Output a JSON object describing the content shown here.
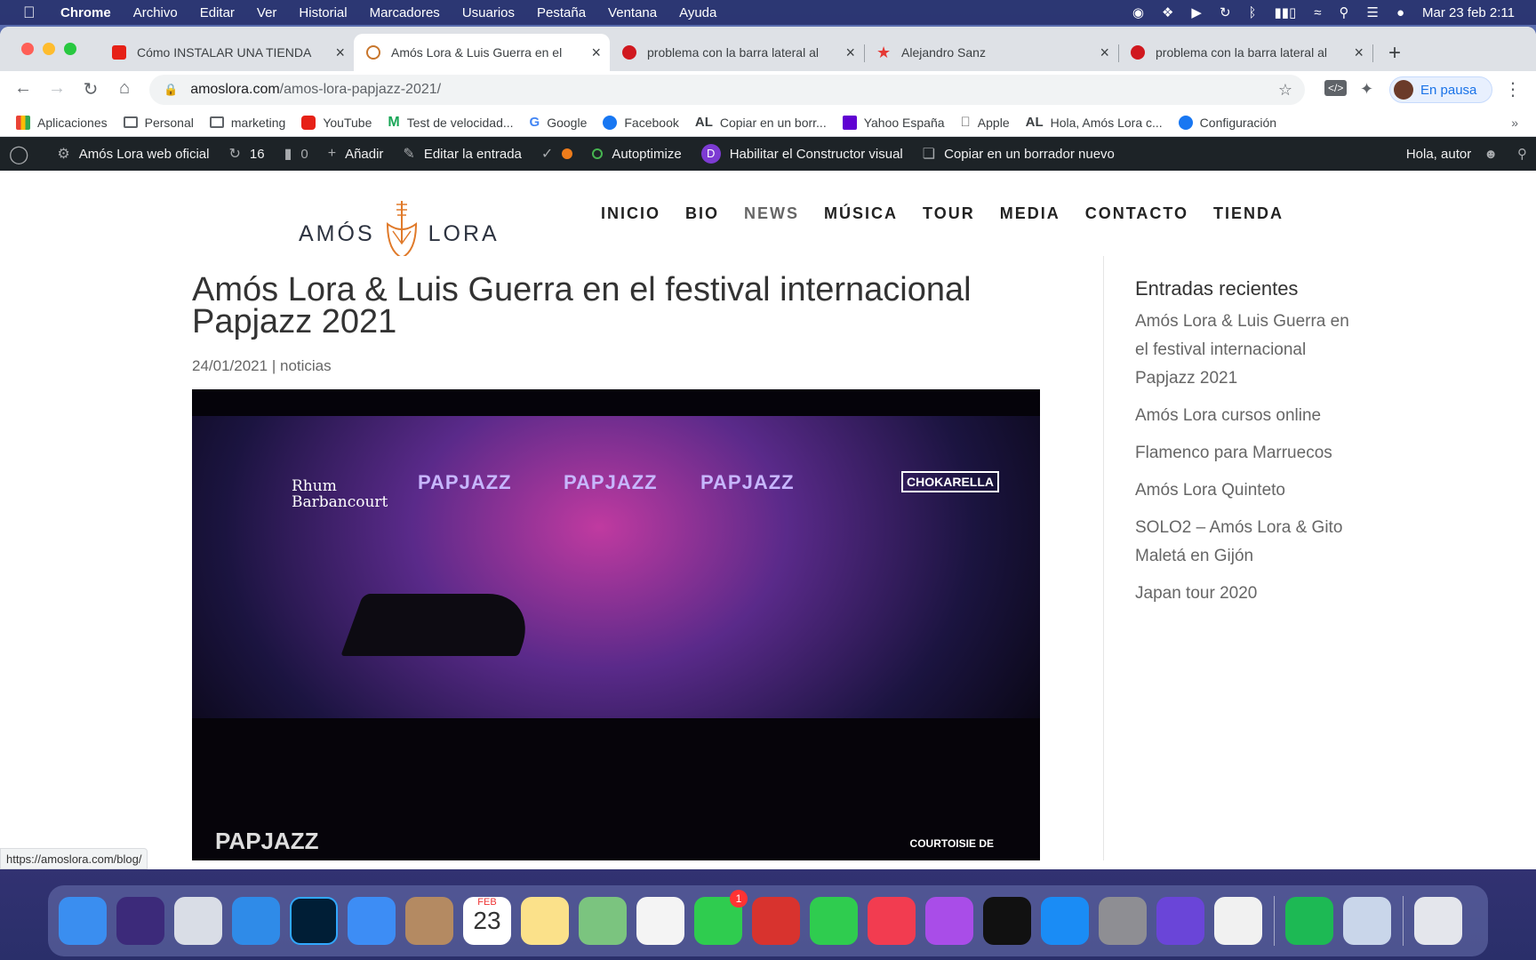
{
  "menubar": {
    "app": "Chrome",
    "items": [
      "Archivo",
      "Editar",
      "Ver",
      "Historial",
      "Marcadores",
      "Usuarios",
      "Pestaña",
      "Ventana",
      "Ayuda"
    ],
    "datetime": "Mar 23 feb  2:11"
  },
  "tabs": [
    {
      "label": "Cómo INSTALAR UNA TIENDA",
      "favicon_color": "#e62117",
      "active": false
    },
    {
      "label": "Amós Lora & Luis Guerra en el",
      "favicon_color": "#c8762c",
      "active": true
    },
    {
      "label": "problema con la barra lateral al",
      "favicon_color": "#d0181f",
      "active": false
    },
    {
      "label": "Alejandro Sanz",
      "favicon_color": "#e53935",
      "active": false
    },
    {
      "label": "problema con la barra lateral al",
      "favicon_color": "#d0181f",
      "active": false
    }
  ],
  "omnibox": {
    "domain": "amoslora.com",
    "path": "/amos-lora-papjazz-2021/"
  },
  "profile": {
    "label": "En pausa"
  },
  "bookmarks": [
    {
      "label": "Aplicaciones",
      "icon": "apps-grid-icon",
      "color": "#4285f4"
    },
    {
      "label": "Personal",
      "icon": "folder-icon",
      "color": "#5f6368"
    },
    {
      "label": "marketing",
      "icon": "folder-icon",
      "color": "#5f6368"
    },
    {
      "label": "YouTube",
      "icon": "youtube-icon",
      "color": "#e62117"
    },
    {
      "label": "Test de velocidad...",
      "icon": "movistar-icon",
      "color": "#19a657"
    },
    {
      "label": "Google",
      "icon": "google-icon",
      "color": "#4285f4"
    },
    {
      "label": "Facebook",
      "icon": "facebook-icon",
      "color": "#1877f2"
    },
    {
      "label": "Copiar en un borr...",
      "icon": "al-icon",
      "color": "#111"
    },
    {
      "label": "Yahoo España",
      "icon": "yahoo-icon",
      "color": "#6001d2"
    },
    {
      "label": "Apple",
      "icon": "apple-icon",
      "color": "#555"
    },
    {
      "label": "Hola, Amós Lora c...",
      "icon": "al-icon",
      "color": "#111"
    },
    {
      "label": "Configuración",
      "icon": "facebook-icon",
      "color": "#1877f2"
    }
  ],
  "wpbar": {
    "site": "Amós Lora web oficial",
    "updates": "16",
    "comments": "0",
    "add": "Añadir",
    "edit": "Editar la entrada",
    "autoptimize": "Autoptimize",
    "visual_builder": "Habilitar el Constructor visual",
    "copy_draft": "Copiar en un borrador nuevo",
    "greeting": "Hola, autor"
  },
  "site": {
    "logo_left": "AMÓS",
    "logo_right": "LORA",
    "nav": [
      "INICIO",
      "BIO",
      "NEWS",
      "MÚSICA",
      "TOUR",
      "MEDIA",
      "CONTACTO",
      "TIENDA"
    ],
    "current_nav": "NEWS"
  },
  "post": {
    "title": "Amós Lora & Luis Guerra en el festival internacional Papjazz 2021",
    "date": "24/01/2021",
    "separator": "|",
    "category": "noticias",
    "video": {
      "banner": "PAPJAZZ",
      "sponsor": "Rhum Barbancourt",
      "chokarella": "CHOKARELLA",
      "bottom_logo": "PAPJAZZ",
      "courtesy": "COURTOISIE DE"
    }
  },
  "sidebar": {
    "title": "Entradas recientes",
    "items": [
      "Amós Lora & Luis Guerra en el festival internacional Papjazz 2021",
      "Amós Lora cursos online",
      "Flamenco para Marruecos",
      "Amós Lora Quinteto",
      "SOLO2 – Amós Lora & Gito Maletá en Gijón",
      "Japan tour 2020"
    ]
  },
  "status_url": "https://amoslora.com/blog/",
  "dock": {
    "calendar_month": "FEB",
    "calendar_day": "23",
    "messages_badge": "1",
    "apps": [
      {
        "name": "finder-icon",
        "color": "#3a8ef0"
      },
      {
        "name": "siri-icon",
        "color": "#3c2a7a"
      },
      {
        "name": "launchpad-icon",
        "color": "#d9dde6"
      },
      {
        "name": "safari-icon",
        "color": "#2f8be8"
      },
      {
        "name": "photoshop-icon",
        "color": "#001e36"
      },
      {
        "name": "mail-icon",
        "color": "#3d8df5"
      },
      {
        "name": "contacts-icon",
        "color": "#b48a62"
      },
      {
        "name": "calendar-icon",
        "color": "#ffffff"
      },
      {
        "name": "notes-icon",
        "color": "#fbe18a"
      },
      {
        "name": "maps-icon",
        "color": "#7bc47f"
      },
      {
        "name": "photos-icon",
        "color": "#f4f4f4"
      },
      {
        "name": "messages-icon",
        "color": "#2fcc4f"
      },
      {
        "name": "photo-booth-icon",
        "color": "#d8332e"
      },
      {
        "name": "facetime-icon",
        "color": "#2fcc4f"
      },
      {
        "name": "music-icon",
        "color": "#f23c50"
      },
      {
        "name": "podcasts-icon",
        "color": "#a94de8"
      },
      {
        "name": "apple-tv-icon",
        "color": "#111111"
      },
      {
        "name": "app-store-icon",
        "color": "#1a8cf5"
      },
      {
        "name": "system-preferences-icon",
        "color": "#8e8e93"
      },
      {
        "name": "imovie-icon",
        "color": "#6a45d8"
      },
      {
        "name": "chrome-icon",
        "color": "#f1f1f1"
      },
      {
        "name": "spotify-icon",
        "color": "#1db954"
      },
      {
        "name": "preview-icon",
        "color": "#c9d6ea"
      },
      {
        "name": "trash-icon",
        "color": "#e4e6ec"
      }
    ]
  }
}
